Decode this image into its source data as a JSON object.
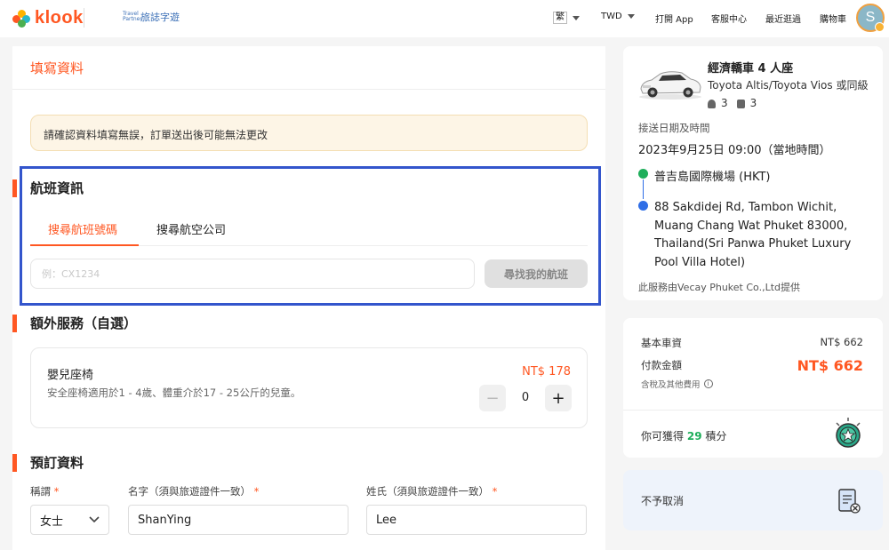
{
  "header": {
    "logo_text": "klook",
    "partner_name": "旅誌字遊",
    "partner_mark": "Travel Partner",
    "nav": {
      "language": "繁",
      "currency": "TWD",
      "open_app": "打開 App",
      "support": "客服中心",
      "recent": "最近逛過",
      "cart": "購物車"
    },
    "avatar_initial": "S"
  },
  "form": {
    "page_title": "填寫資料",
    "notice": "請確認資料填寫無誤，訂單送出後可能無法更改",
    "flight": {
      "title": "航班資訊",
      "tabs": [
        "搜尋航班號碼",
        "搜尋航空公司"
      ],
      "active_tab": 0,
      "input_placeholder": "例：CX1234",
      "find_button": "尋找我的航班"
    },
    "extras": {
      "title": "額外服務（自選）",
      "item_name": "嬰兒座椅",
      "item_desc": "安全座椅適用於1 - 4歲、體重介於17 - 25公斤的兒童。",
      "item_price": "NT$ 178",
      "quantity": "0",
      "minus": "−",
      "plus": "+"
    },
    "booking": {
      "title": "預訂資料",
      "title_label": "稱謂",
      "title_value": "女士",
      "first_name_label": "名字（須與旅遊證件一致）",
      "first_name_value": "ShanYing",
      "last_name_label": "姓氏（須與旅遊證件一致）",
      "last_name_value": "Lee",
      "required_mark": "*"
    }
  },
  "summary": {
    "car_title": "經濟轎車 4 人座",
    "car_models": "Toyota Altis/Toyota Vios 或同級",
    "passengers": "3",
    "luggage": "3",
    "date_label": "接送日期及時間",
    "date_value": "2023年9月25日 09:00（當地時間）",
    "from": "普吉島國際機場 (HKT)",
    "to": "88 Sakdidej Rd, Tambon Wichit, Muang Chang Wat Phuket 83000, Thailand(Sri Panwa Phuket Luxury Pool Villa Hotel)",
    "provider": "此服務由Vecay Phuket Co.,Ltd提供"
  },
  "pricing": {
    "base_label": "基本車資",
    "base_value": "NT$ 662",
    "pay_label": "付款金額",
    "pay_value": "NT$ 662",
    "tax_note": "含稅及其他費用",
    "points_prefix": "你可獲得",
    "points_value": "29",
    "points_suffix": "積分"
  },
  "cancellation": {
    "text": "不予取消"
  },
  "colors": {
    "brand": "#ff5722",
    "highlight": "#3355cc",
    "route_from": "#1fae5b",
    "route_to": "#2f6ee6"
  }
}
